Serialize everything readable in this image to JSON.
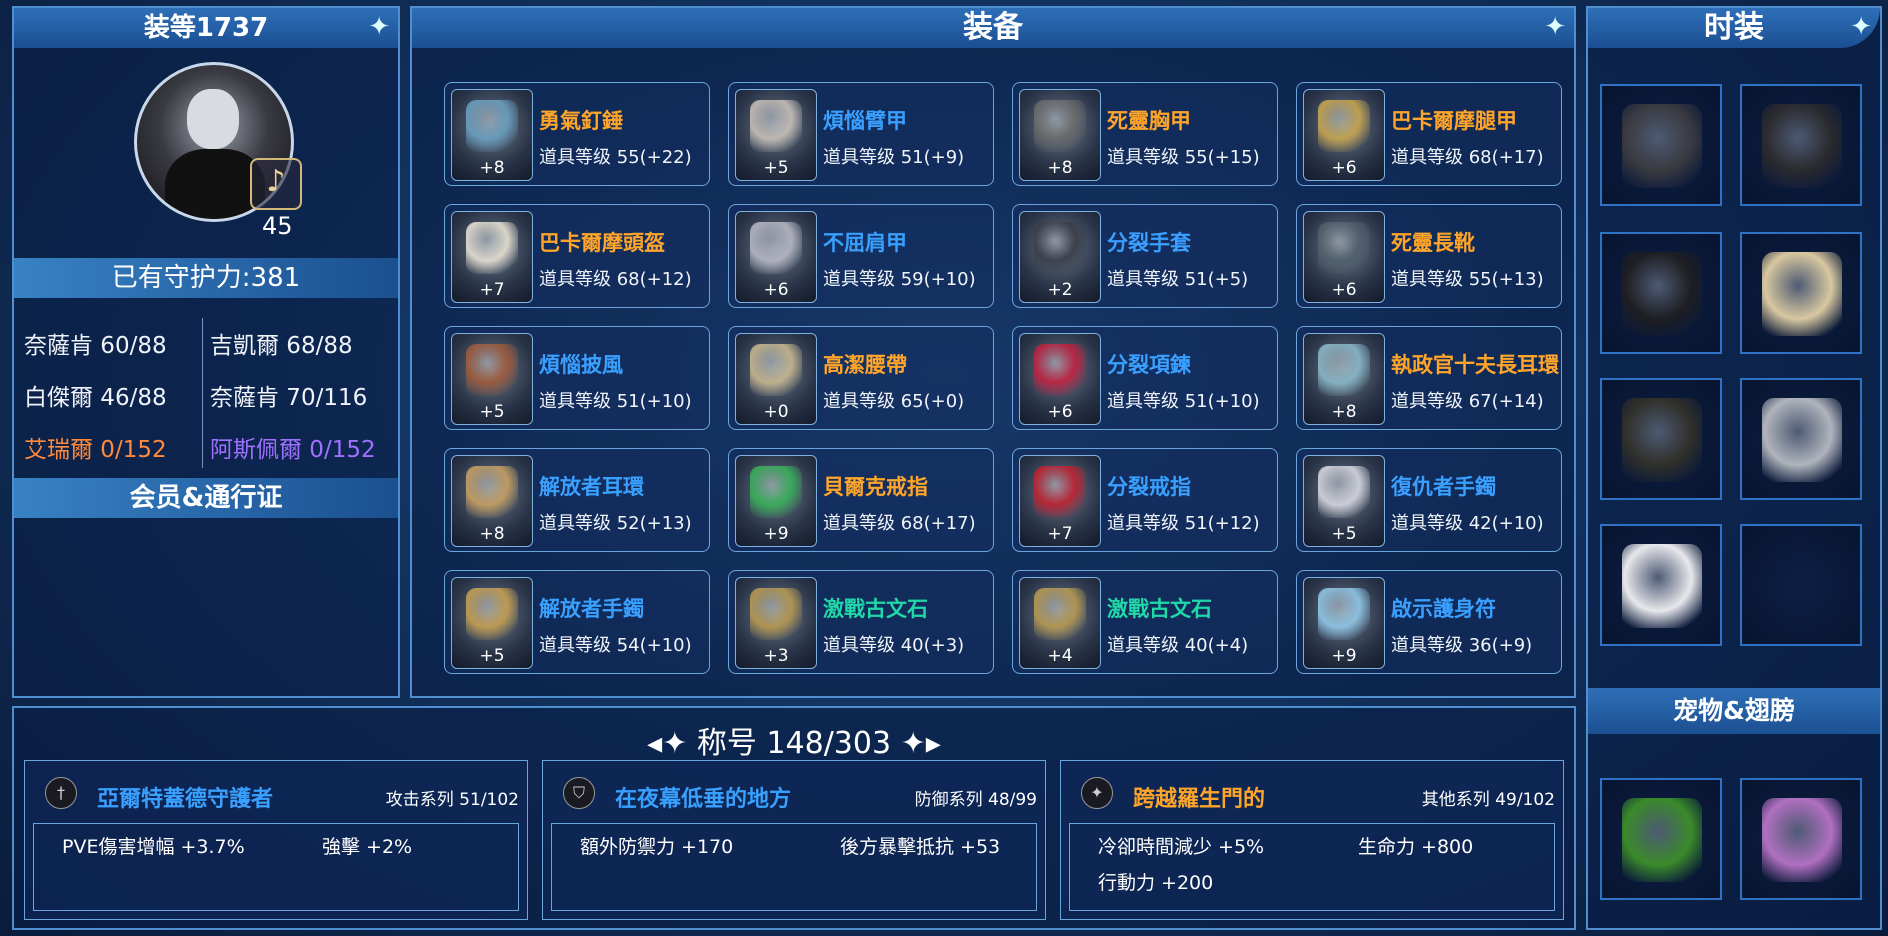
{
  "left": {
    "title": "装等1737",
    "level": "45",
    "defense": "已有守护力:381",
    "stats": [
      {
        "text": "奈薩肯 60/88",
        "color": "#f0f4fa"
      },
      {
        "text": "吉凱爾 68/88",
        "color": "#f0f4fa"
      },
      {
        "text": "白傑爾 46/88",
        "color": "#f0f4fa"
      },
      {
        "text": "奈薩肯 70/116",
        "color": "#f0f4fa"
      },
      {
        "text": "艾瑞爾 0/152",
        "color": "#ff8a3c"
      },
      {
        "text": "阿斯佩爾 0/152",
        "color": "#a070ff"
      }
    ],
    "membership": "会员&通行证"
  },
  "equip": {
    "title": "装备",
    "items": [
      {
        "name": "勇氣釘錘",
        "level": "道具等级 55(+22)",
        "plus": "+8",
        "color": "#ffa52a",
        "icon": "hammer-icon",
        "tint": "#6aa0c0"
      },
      {
        "name": "煩惱臂甲",
        "level": "道具等级 51(+9)",
        "plus": "+5",
        "color": "#3aa0ff",
        "icon": "bracer-icon",
        "tint": "#c8c0b8"
      },
      {
        "name": "死靈胸甲",
        "level": "道具等级 55(+15)",
        "plus": "+8",
        "color": "#ffa52a",
        "icon": "chestplate-icon",
        "tint": "#6a6a6a"
      },
      {
        "name": "巴卡爾摩腿甲",
        "level": "道具等级 68(+17)",
        "plus": "+6",
        "color": "#ffa52a",
        "icon": "leggings-icon",
        "tint": "#c9a64e"
      },
      {
        "name": "巴卡爾摩頭盔",
        "level": "道具等级 68(+12)",
        "plus": "+7",
        "color": "#ffa52a",
        "icon": "helmet-icon",
        "tint": "#e8e2d4"
      },
      {
        "name": "不屈肩甲",
        "level": "道具等级 59(+10)",
        "plus": "+6",
        "color": "#3aa0ff",
        "icon": "shoulder-icon",
        "tint": "#b8b8c4"
      },
      {
        "name": "分裂手套",
        "level": "道具等级 51(+5)",
        "plus": "+2",
        "color": "#3aa0ff",
        "icon": "gloves-icon",
        "tint": "#3a3e48"
      },
      {
        "name": "死靈長靴",
        "level": "道具等级 55(+13)",
        "plus": "+6",
        "color": "#ffa52a",
        "icon": "boots-icon",
        "tint": "#50606c"
      },
      {
        "name": "煩惱披風",
        "level": "道具等级 51(+10)",
        "plus": "+5",
        "color": "#3aa0ff",
        "icon": "cape-icon",
        "tint": "#a05a3a"
      },
      {
        "name": "高潔腰帶",
        "level": "道具等级 65(+0)",
        "plus": "+0",
        "color": "#ffa52a",
        "icon": "belt-icon",
        "tint": "#c8b890"
      },
      {
        "name": "分裂項鍊",
        "level": "道具等级 51(+10)",
        "plus": "+6",
        "color": "#3aa0ff",
        "icon": "necklace-icon",
        "tint": "#c02040"
      },
      {
        "name": "執政官十夫長耳環",
        "level": "道具等级 67(+14)",
        "plus": "+8",
        "color": "#ffa52a",
        "icon": "earring-icon",
        "tint": "#8ab8c8"
      },
      {
        "name": "解放者耳環",
        "level": "道具等级 52(+13)",
        "plus": "+8",
        "color": "#3aa0ff",
        "icon": "earring-icon",
        "tint": "#c8a060"
      },
      {
        "name": "貝爾克戒指",
        "level": "道具等级 68(+17)",
        "plus": "+9",
        "color": "#ffa52a",
        "icon": "ring-icon",
        "tint": "#38b058"
      },
      {
        "name": "分裂戒指",
        "level": "道具等级 51(+12)",
        "plus": "+7",
        "color": "#3aa0ff",
        "icon": "ring-icon",
        "tint": "#c02030"
      },
      {
        "name": "復仇者手鐲",
        "level": "道具等级 42(+10)",
        "plus": "+5",
        "color": "#3aa0ff",
        "icon": "bracelet-icon",
        "tint": "#d8d8e0"
      },
      {
        "name": "解放者手鐲",
        "level": "道具等级 54(+10)",
        "plus": "+5",
        "color": "#3aa0ff",
        "icon": "bracelet-icon",
        "tint": "#c8a050"
      },
      {
        "name": "激戰古文石",
        "level": "道具等级 40(+3)",
        "plus": "+3",
        "color": "#20d8a8",
        "icon": "rune-stone-icon",
        "tint": "#b89a50"
      },
      {
        "name": "激戰古文石",
        "level": "道具等级 40(+4)",
        "plus": "+4",
        "color": "#20d8a8",
        "icon": "rune-stone-icon",
        "tint": "#b89a50"
      },
      {
        "name": "啟示護身符",
        "level": "道具等级 36(+9)",
        "plus": "+9",
        "color": "#3aa0ff",
        "icon": "amulet-icon",
        "tint": "#90c8e8"
      }
    ]
  },
  "fashion": {
    "title": "时装",
    "slots": [
      {
        "icon": "top-costume-icon",
        "tint": "#3a3a40"
      },
      {
        "icon": "shorts-costume-icon",
        "tint": "#2a2a2e"
      },
      {
        "icon": "boots-costume-icon",
        "tint": "#1e1e22"
      },
      {
        "icon": "gloves-costume-icon",
        "tint": "#d8c8a0"
      },
      {
        "icon": "weapon-costume-icon",
        "tint": "#30302a"
      },
      {
        "icon": "shoulder-costume-icon",
        "tint": "#b0b4bc"
      },
      {
        "icon": "mask-costume-icon",
        "tint": "#e8e8ec"
      },
      {
        "icon": "empty-slot-icon",
        "tint": ""
      }
    ],
    "pet_title": "宠物&翅膀",
    "pets": [
      {
        "icon": "pet-icon",
        "tint": "#3a8a2a"
      },
      {
        "icon": "wings-icon",
        "tint": "#b070c0"
      }
    ]
  },
  "titles": {
    "header": "称号 148/303",
    "groups": [
      {
        "name": "亞爾特蓋德守護者",
        "color": "#3aa0ff",
        "category": "攻击系列 51/102",
        "icon": "sword-icon",
        "stats": [
          "PVE傷害增幅 +3.7%",
          "強擊 +2%"
        ]
      },
      {
        "name": "在夜幕低垂的地方",
        "color": "#3aa0ff",
        "category": "防御系列 48/99",
        "icon": "shield-icon",
        "stats": [
          "額外防禦力 +170",
          "後方暴擊抵抗 +53"
        ]
      },
      {
        "name": "跨越羅生門的",
        "color": "#ffa52a",
        "category": "其他系列 49/102",
        "icon": "star-icon",
        "stats": [
          "冷卻時間減少 +5%",
          "生命力 +800",
          "行動力 +200"
        ]
      }
    ]
  }
}
